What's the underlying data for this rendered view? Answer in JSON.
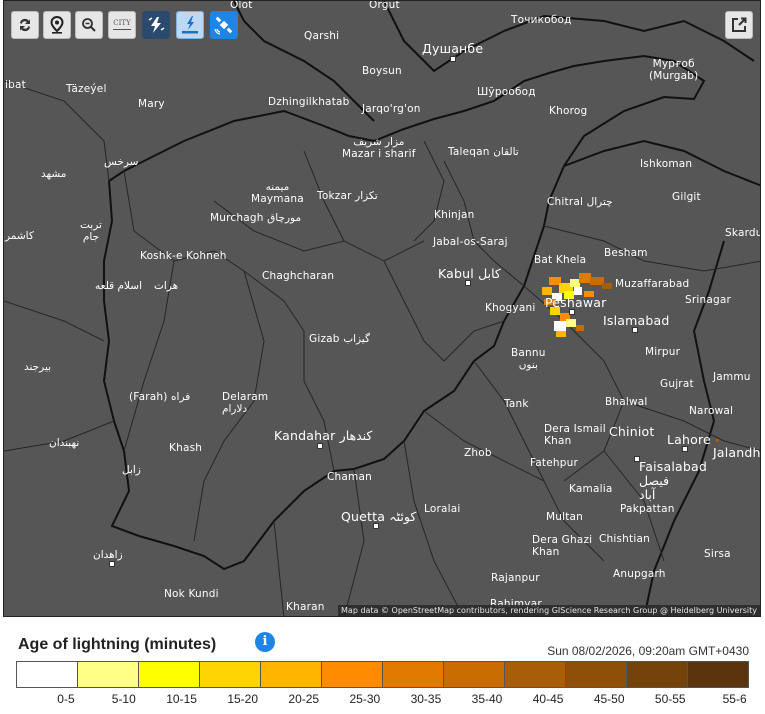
{
  "toolbar": {
    "refresh": "refresh-icon",
    "location": "location-pin-icon",
    "zoom_out": "zoom-out-icon",
    "city_label": "CITY",
    "lightning": "lightning-icon",
    "strike": "lightning-strike-icon",
    "satellite": "satellite-icon",
    "share": "share-icon"
  },
  "map": {
    "attribution": "Map data © OpenStreetMap contributors, rendering GIScience Research Group @ Heidelberg University",
    "labels": {
      "olot": "Olot",
      "orgut": "Orgut",
      "tochikobod": "Точикобод",
      "qarshi": "Qarshi",
      "dushanbe": "Душанбе",
      "murgab": "Мурғоб\n(Murgab)",
      "ibat": "ibat",
      "tazeyel": "Täzeýel",
      "mary": "Mary",
      "boysun": "Boysun",
      "dzhingilkhatab": "Dzhingilkhatab",
      "jarqorgon": "Jarqo'rg'on",
      "shurobod": "Шўрообод",
      "khorog": "Khorog",
      "serkhs": "سرخس",
      "mashhad": "مشهد",
      "mazar": "مزار شریف\nMazar i sharif",
      "taleqan": "Taleqan تالقان",
      "ishkoman": "Ishkoman",
      "maymana": "میمنه\nMaymana",
      "tokzar": "Tokzar تکزار",
      "chitral": "Chitral چترال",
      "gilgit": "Gilgit",
      "torbat": "تربت\nجام",
      "kashmar": "کاشمر",
      "murchagh": "Murchagh مورچاق",
      "khinjan": "Khinjan",
      "jabal": "Jabal-os-Saraj",
      "skardu": "Skardu",
      "koshk": "Koshk-e Kohneh",
      "besham": "Besham",
      "batkhela": "Bat Khela",
      "chaghcharan": "Chaghcharan",
      "kabul": "Kabul کابل",
      "muzaffarabad": "Muzaffarabad",
      "islamqala": "اسلام قلعه",
      "herat": "هرات",
      "peshawar": "Peshawar",
      "srinagar": "Srinagar",
      "khogyani": "Khogyani",
      "islamabad": "Islamabad",
      "gizab": "Gizab گیزاب",
      "bannu": "Bannu\nبنوں",
      "mirpur": "Mirpur",
      "birjand": "بیرجند",
      "jammu": "Jammu",
      "farah": "(Farah) فراه",
      "delaram": "Delaram\nدلارام",
      "gujrat": "Gujrat",
      "bhalwal": "Bhalwal",
      "tank": "Tank",
      "narowal": "Narowal",
      "nehbandan": "نهبندان",
      "khash": "Khash",
      "kandahar": "Kandahar کندهار",
      "deraismail": "Dera Ismail\nKhan",
      "chiniot": "Chiniot",
      "lahore": "Lahore",
      "jalandhar": "Jalandha",
      "zabol": "زابل",
      "zhob": "Zhob",
      "fatehpur": "Fatehpur",
      "faisalabad": "Faisalabad\nفیصل\nآباد",
      "chaman": "Chaman",
      "kamalia": "Kamalia",
      "quetta": "Quetta کوئٹہ",
      "loralai": "Loralai",
      "multan": "Multan",
      "pakpattan": "Pakpattan",
      "zahedan": "زاهدان",
      "deraghazi": "Dera Ghazi\nKhan",
      "chishtian": "Chishtian",
      "sirsa": "Sirsa",
      "anupgarh": "Anupgarh",
      "rajanpur": "Rajanpur",
      "nokkundi": "Nok Kundi",
      "kharan": "Kharan",
      "rahimyar": "Rahimyar"
    }
  },
  "legend": {
    "title": "Age of lightning (minutes)",
    "info": "i",
    "timestamp": "Sun 08/02/2026, 09:20am GMT+0430",
    "colors": [
      "#ffffff",
      "#ffff88",
      "#ffff00",
      "#ffd400",
      "#ffb400",
      "#ff8c00",
      "#e07a00",
      "#c86c00",
      "#a85e08",
      "#8e5008",
      "#74420a",
      "#5a340c"
    ],
    "ticks": [
      "0-5",
      "5-10",
      "10-15",
      "15-20",
      "20-25",
      "25-30",
      "30-35",
      "35-40",
      "40-45",
      "45-50",
      "50-55",
      "55-6"
    ]
  }
}
